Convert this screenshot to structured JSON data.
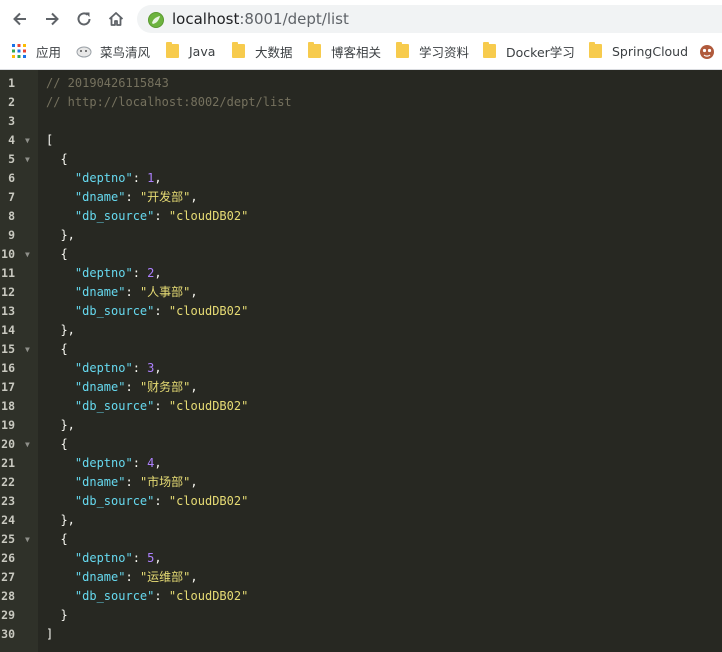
{
  "browser": {
    "url_host": "localhost",
    "url_rest": ":8001/dept/list"
  },
  "bookmarks": [
    {
      "label": "应用",
      "icon": "apps-grid-icon"
    },
    {
      "label": "菜鸟清风",
      "icon": "runoob-icon"
    },
    {
      "label": "Java",
      "icon": "folder-icon"
    },
    {
      "label": "大数据",
      "icon": "folder-icon"
    },
    {
      "label": "博客相关",
      "icon": "folder-icon"
    },
    {
      "label": "学习资料",
      "icon": "folder-icon"
    },
    {
      "label": "Docker学习",
      "icon": "folder-icon"
    },
    {
      "label": "SpringCloud",
      "icon": "folder-icon"
    }
  ],
  "json_view": {
    "comment_timestamp": "// 20190426115843",
    "comment_url": "// http://localhost:8002/dept/list",
    "records": [
      {
        "deptno": "1",
        "dname": "开发部",
        "db_source": "cloudDB02"
      },
      {
        "deptno": "2",
        "dname": "人事部",
        "db_source": "cloudDB02"
      },
      {
        "deptno": "3",
        "dname": "财务部",
        "db_source": "cloudDB02"
      },
      {
        "deptno": "4",
        "dname": "市场部",
        "db_source": "cloudDB02"
      },
      {
        "deptno": "5",
        "dname": "运维部",
        "db_source": "cloudDB02"
      }
    ],
    "line_count": 30
  },
  "colors": {
    "editor_bg": "#272822",
    "gutter_bg": "#2f3129",
    "comment": "#75715e",
    "key": "#66d9ef",
    "number": "#ae81ff",
    "string": "#e6db74",
    "folder": "#f7cb4d"
  }
}
